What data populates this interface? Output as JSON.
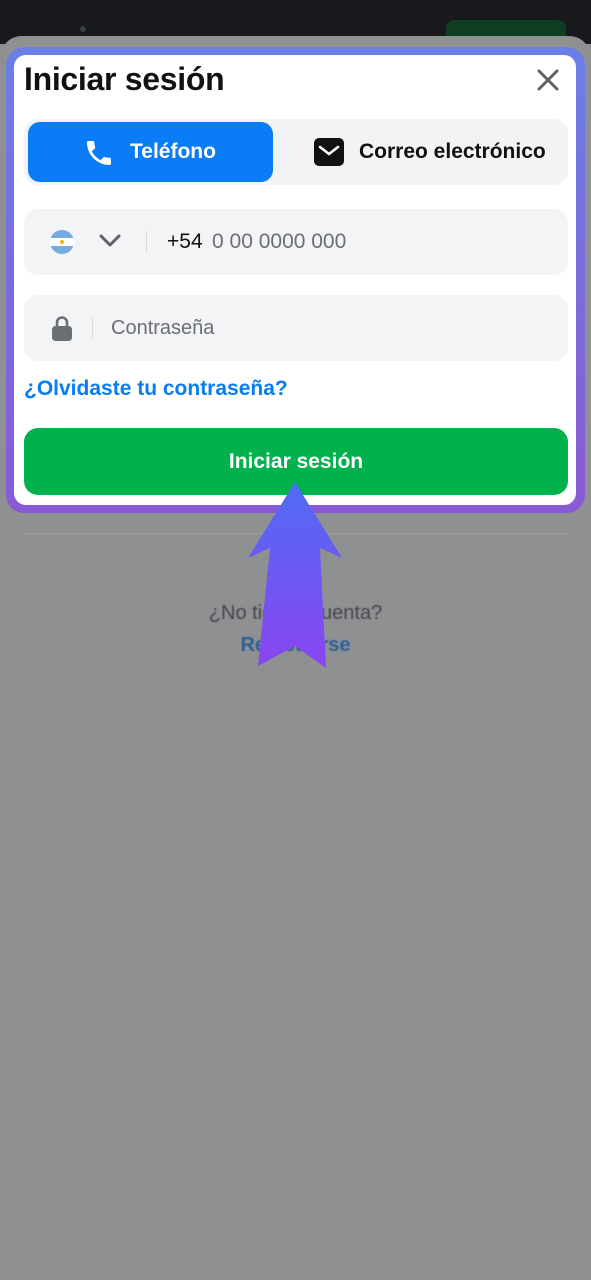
{
  "modal": {
    "title": "Iniciar sesión",
    "close_icon": "close-icon"
  },
  "tabs": [
    {
      "label": "Teléfono",
      "icon": "phone-icon",
      "active": true
    },
    {
      "label": "Correo electrónico",
      "icon": "envelope-icon",
      "active": false
    }
  ],
  "phone_field": {
    "country_flag": "argentina-flag-icon",
    "prefix": "+54",
    "placeholder": "0 00 0000 000",
    "value": ""
  },
  "password_field": {
    "icon": "lock-icon",
    "placeholder": "Contraseña",
    "value": ""
  },
  "forgot_link": "¿Olvidaste tu contraseña?",
  "submit_label": "Iniciar sesión",
  "background": {
    "question": "¿No tienes cuenta?",
    "register_link": "Registrarse"
  },
  "colors": {
    "accent_blue": "#0a7cf5",
    "submit_green": "#00b14c",
    "highlight_gradient_start": "#6b7fe6",
    "highlight_gradient_end": "#8a5ad6"
  }
}
